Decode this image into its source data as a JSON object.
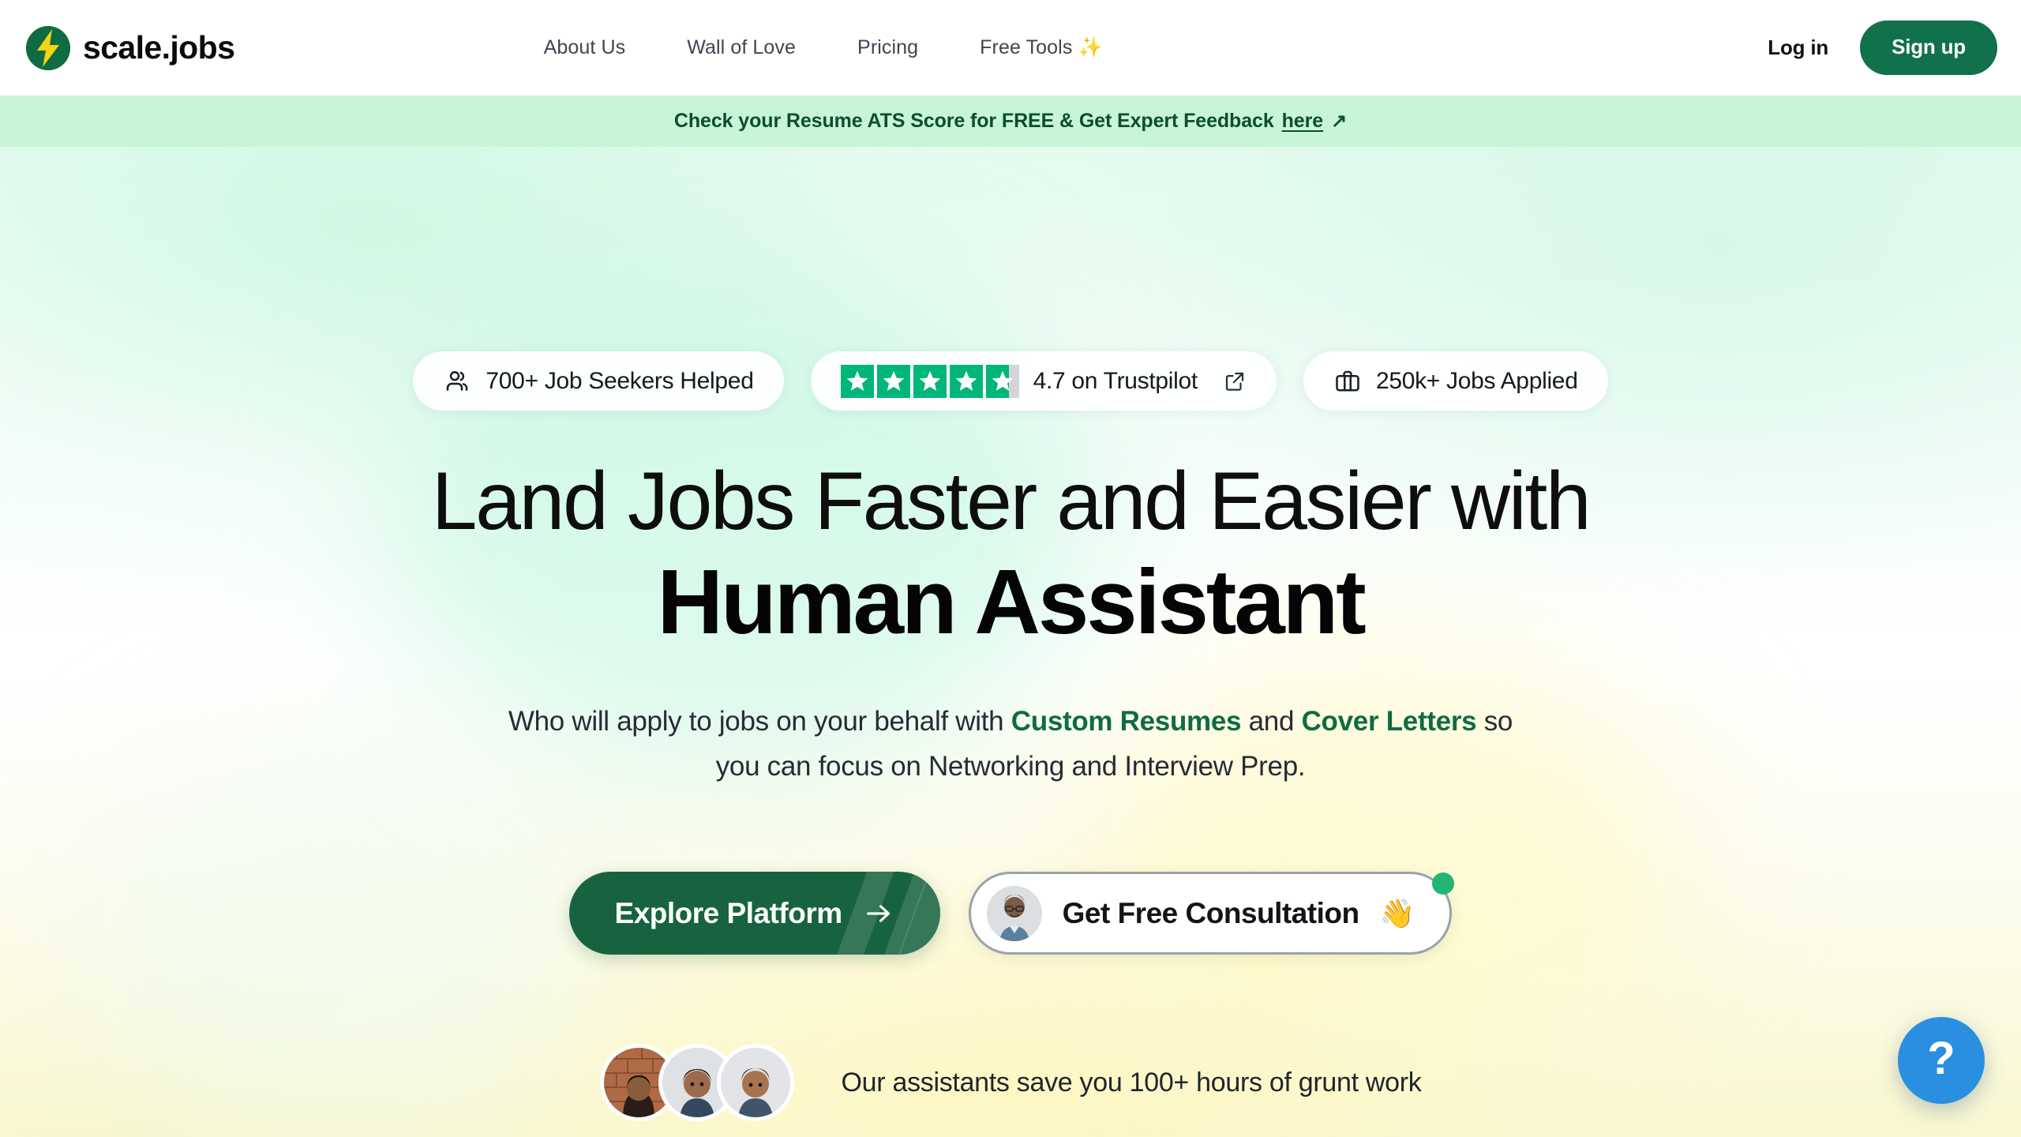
{
  "brand": {
    "name": "scale.jobs",
    "logo_icon": "lightning-bolt-icon",
    "logo_bg_color": "#0f6b42",
    "logo_bolt_color": "#f5d516"
  },
  "nav": {
    "items": [
      {
        "label": "About Us",
        "name": "about-us"
      },
      {
        "label": "Wall of Love",
        "name": "wall-of-love"
      },
      {
        "label": "Pricing",
        "name": "pricing"
      },
      {
        "label": "Free Tools ✨",
        "name": "free-tools"
      }
    ],
    "login_label": "Log in",
    "signup_label": "Sign up",
    "signup_color": "#11714b"
  },
  "banner": {
    "text": "Check your Resume ATS Score for FREE & Get Expert Feedback",
    "link_label": "here",
    "arrow": "↗",
    "bg_color": "#c7f5d6",
    "text_color": "#0c4d30"
  },
  "hero": {
    "pills": [
      {
        "name": "job-seekers-helped",
        "icon": "users-icon",
        "text": "700+ Job Seekers Helped"
      },
      {
        "name": "trustpilot-rating",
        "icon": "trustpilot-stars-icon",
        "text": "4.7 on Trustpilot",
        "rating": 4.7,
        "stars_total": 5,
        "star_color": "#00b67a",
        "external_link_icon": "external-link-icon"
      },
      {
        "name": "jobs-applied",
        "icon": "briefcase-icon",
        "text": "250k+ Jobs Applied"
      }
    ],
    "headline_line1": "Land Jobs Faster and Easier with",
    "headline_line2": "Human Assistant",
    "subtitle": {
      "part1": "Who will apply to jobs on your behalf with ",
      "highlight1": "Custom Resumes",
      "part2": " and ",
      "highlight2": "Cover Letters",
      "part3": " so you can focus on Networking and Interview Prep.",
      "highlight_color": "#0f6b42"
    },
    "cta_primary": {
      "label": "Explore Platform",
      "arrow_icon": "arrow-right-icon",
      "bg_color": "#18633f"
    },
    "cta_secondary": {
      "label": "Get Free Consultation",
      "emoji": "👋",
      "avatar_icon": "consultant-avatar",
      "status_dot_color": "#22b573"
    },
    "proof_text": "Our assistants save you 100+ hours of grunt work",
    "avatar_count": 3
  },
  "help": {
    "label": "?",
    "name": "help-button",
    "bg_color": "#2a8fe0"
  }
}
